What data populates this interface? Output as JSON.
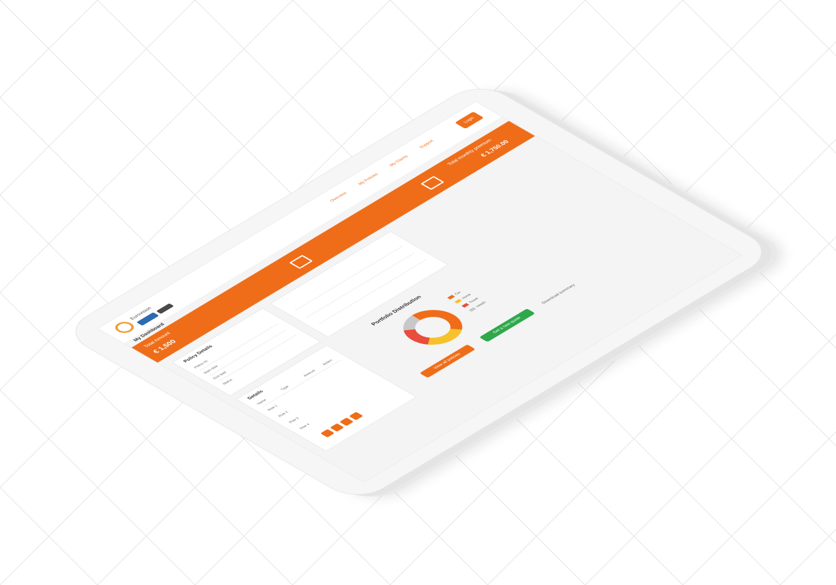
{
  "app": {
    "brand": "Eurovision",
    "title": "My Dashboard"
  },
  "nav": {
    "items": [
      "Overview",
      "My Policies",
      "My Claims",
      "Support"
    ],
    "login_label": "Login"
  },
  "banner": {
    "left_text": "Total Amount",
    "left_value": "€ 1,500",
    "right_text": "Total monthly premium",
    "right_value": "€ 1,750.00"
  },
  "policy_panel": {
    "title": "Policy Details",
    "rows": [
      "Policy no.",
      "Start date",
      "End date",
      "Status"
    ]
  },
  "info_panel": {
    "title": "Details",
    "columns": [
      "Name",
      "Type",
      "Amount",
      "Action"
    ],
    "rows": [
      "Row 1",
      "Row 2",
      "Row 3",
      "Row 4"
    ]
  },
  "chart": {
    "title": "Portfolio Distribution",
    "legend": [
      "Car",
      "Home",
      "Travel",
      "Health"
    ],
    "colors": [
      "#ef6d19",
      "#f6c12b",
      "#e84d3d",
      "#c8c8c8"
    ],
    "primary_button": "View all policies",
    "secondary_button": "Get a new quote",
    "link": "Download summary"
  },
  "chart_data": {
    "type": "pie",
    "categories": [
      "Car",
      "Home",
      "Travel",
      "Health"
    ],
    "values": [
      40,
      25,
      20,
      15
    ]
  }
}
